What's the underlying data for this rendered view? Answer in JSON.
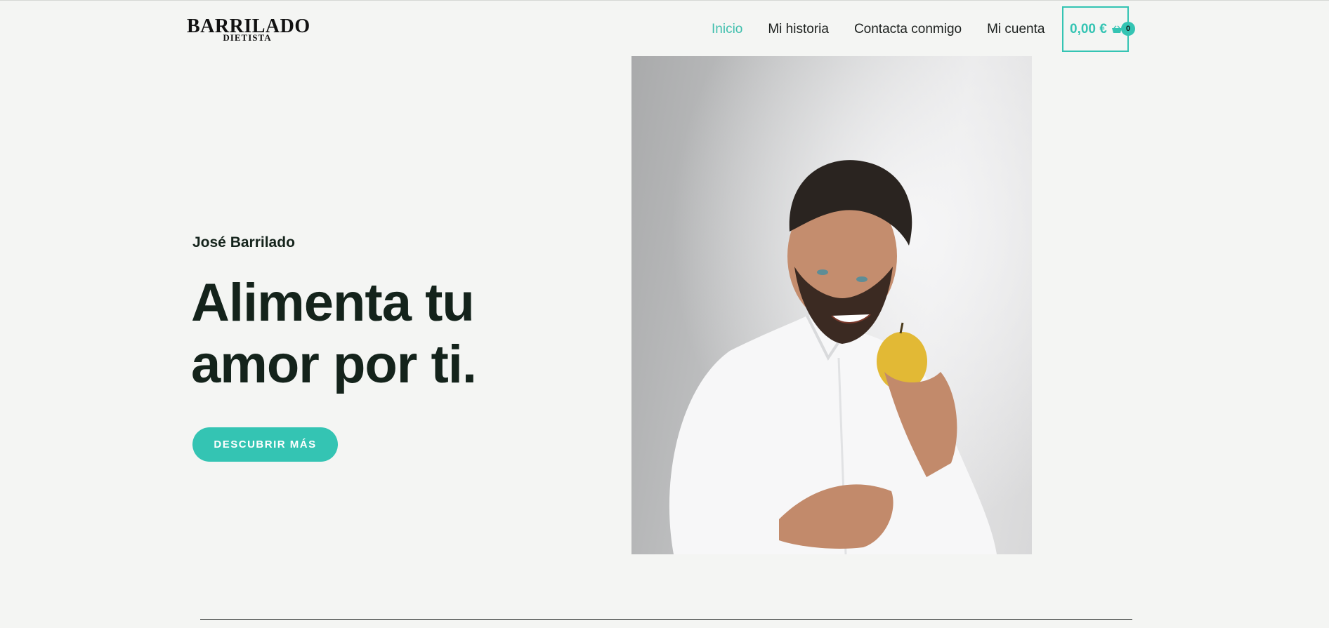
{
  "header": {
    "logo": {
      "main": "BARRILADO",
      "sub": "DIETISTA"
    },
    "nav": [
      {
        "label": "Inicio",
        "active": true
      },
      {
        "label": "Mi historia",
        "active": false
      },
      {
        "label": "Contacta conmigo",
        "active": false
      },
      {
        "label": "Mi cuenta",
        "active": false
      }
    ],
    "cart": {
      "total": "0,00 €",
      "count": "0",
      "icon": "shopping-basket-icon"
    }
  },
  "hero": {
    "name": "José Barrilado",
    "title_line1": "Alimenta tu",
    "title_line2": "amor por ti.",
    "button_label": "DESCUBRIR MÁS"
  },
  "colors": {
    "accent": "#34c4b3",
    "background": "#f4f5f3",
    "text": "#14231b"
  }
}
